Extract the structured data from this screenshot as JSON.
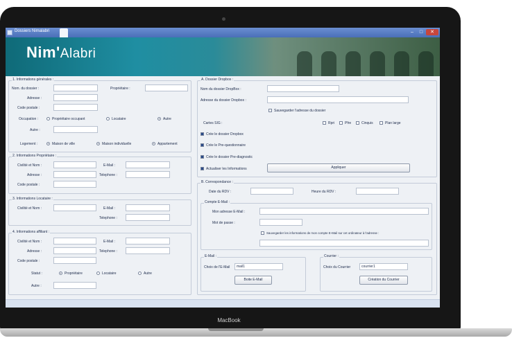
{
  "device": {
    "brand": "MacBook"
  },
  "window": {
    "title": "Dossiers Nimalabri",
    "min": "–",
    "max": "□",
    "close": "✕"
  },
  "banner": {
    "logo_main": "Nim'",
    "logo_sub": "Alabri"
  },
  "general": {
    "title": "1. Informations générales :",
    "folder_name_label": "Nom. du dossier :",
    "folder_name_value": "",
    "owner_label": "Propriétaire :",
    "owner_value": "",
    "address_label": "Adresse :",
    "address_value": "",
    "postal_label": "Code postale :",
    "postal_value": "",
    "occupation_label": "Occupation :",
    "occupation_options": [
      "Propriétaire occupant",
      "Locataire",
      "Autre"
    ],
    "occupation_selected": "Autre",
    "other_label": "Autre :",
    "other_value": "",
    "housing_label": "Logement :",
    "housing_options": [
      "Maison de ville",
      "Maison individuelle",
      "Appartement"
    ],
    "housing_selected": "all"
  },
  "owners": {
    "title": "2. Informations Propriétaire :",
    "name_label": "Civilité et Nom :",
    "email_label": "E-Mail :",
    "address_label": "Adresse :",
    "phone_label": "Telephone :",
    "postal_label": "Code postale :"
  },
  "tenants": {
    "title": "3. Informations Locataire :",
    "name_label": "Civilité et Nom :",
    "email_label": "E-Mail :",
    "phone_label": "Telephone :"
  },
  "affected": {
    "title": "4. Informations affiliant :",
    "name_label": "Civilité et Nom :",
    "email_label": "E-Mail :",
    "address_label": "Adresse :",
    "phone_label": "Telephone :",
    "postal_label": "Code postale :",
    "status_label": "Statut :",
    "status_options": [
      "Propriétaire",
      "Locataire",
      "Autre"
    ],
    "status_selected": "Propriétaire",
    "other_label": "Autre :"
  },
  "dropbox": {
    "title": "A. Dossier Dropbox :",
    "folder_label": "Nom du dossier DropBox :",
    "address_label": "Adresse du dossier Dropbox :",
    "save_address_label": "Sauvegarder l'adresse du dossier",
    "save_address_checked": false,
    "maps_label": "Cartes SIG :",
    "map_options": [
      "Rpri",
      "Pfre",
      "Cinquis",
      "Plan large"
    ],
    "checkboxes": [
      {
        "label": "Crée le dossier Dropbox",
        "checked": true
      },
      {
        "label": "Crée le Pre-questionnaire",
        "checked": true
      },
      {
        "label": "Crée le dossier Pre-diagnostic",
        "checked": true
      },
      {
        "label": "Actualiser les Informations",
        "checked": true
      }
    ],
    "apply_label": "Appliquer"
  },
  "correspondence": {
    "title": "B. Correspondance :",
    "date_label": "Date du RDV :",
    "time_label": "Heure du RDV :",
    "email_account_title": "Compte E-Mail :",
    "my_email_label": "Mon adresse E-Mail :",
    "password_label": "Mot de passe :",
    "save_info_label": "Sauvegarder les informations de mon compte E-Mail sur cet ordinateur à l'adresse :",
    "save_info_checked": false,
    "email_group_title": "E-Mail :",
    "email_template_label": "Choix de l'E-Mail",
    "email_template_value": "mail1",
    "email_button": "Boite E-Mail",
    "mail_group_title": "Courrier :",
    "mail_template_label": "Choix du Courrier",
    "mail_template_value": "courrier1",
    "mail_button": "Création du Courrier"
  }
}
